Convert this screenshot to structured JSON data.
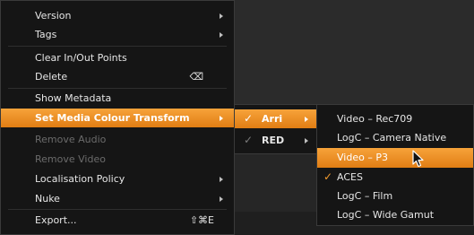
{
  "main_menu": {
    "items": [
      {
        "label": "Version",
        "submenu": true,
        "disabled": false
      },
      {
        "label": "Tags",
        "submenu": true,
        "disabled": false
      },
      {
        "label": "Clear In/Out Points",
        "submenu": false,
        "disabled": false
      },
      {
        "label": "Delete",
        "shortcut": "⌫",
        "submenu": false,
        "disabled": false
      },
      {
        "label": "Show Metadata",
        "submenu": false,
        "disabled": false
      },
      {
        "label": "Set Media Colour Transform",
        "submenu": true,
        "selected": true
      },
      {
        "label": "Remove Audio",
        "submenu": false,
        "disabled": true
      },
      {
        "label": "Remove Video",
        "submenu": false,
        "disabled": true
      },
      {
        "label": "Localisation Policy",
        "submenu": true,
        "disabled": false
      },
      {
        "label": "Nuke",
        "submenu": true,
        "disabled": false
      },
      {
        "label": "Export...",
        "shortcut": "⇧⌘E",
        "submenu": false,
        "disabled": false
      }
    ]
  },
  "vendor_menu": {
    "items": [
      {
        "label": "Arri",
        "checked": true,
        "selected": true
      },
      {
        "label": "RED",
        "checked": true,
        "selected": false
      }
    ]
  },
  "transform_menu": {
    "items": [
      {
        "label": "Video – Rec709",
        "checked": false
      },
      {
        "label": "LogC – Camera Native",
        "checked": false
      },
      {
        "label": "Video – P3",
        "checked": false,
        "highlighted": true
      },
      {
        "label": "ACES",
        "checked": true
      },
      {
        "label": "LogC – Film",
        "checked": false
      },
      {
        "label": "LogC – Wide Gamut",
        "checked": false
      }
    ]
  },
  "icons": {
    "check": "checkmark-icon",
    "submenu": "submenu-arrow-icon",
    "cursor": "mouse-pointer-icon"
  },
  "colors": {
    "accent": "#f29b2d",
    "menu_bg": "#151515",
    "text": "#e6e6e6",
    "disabled_text": "#6b6b6b"
  }
}
